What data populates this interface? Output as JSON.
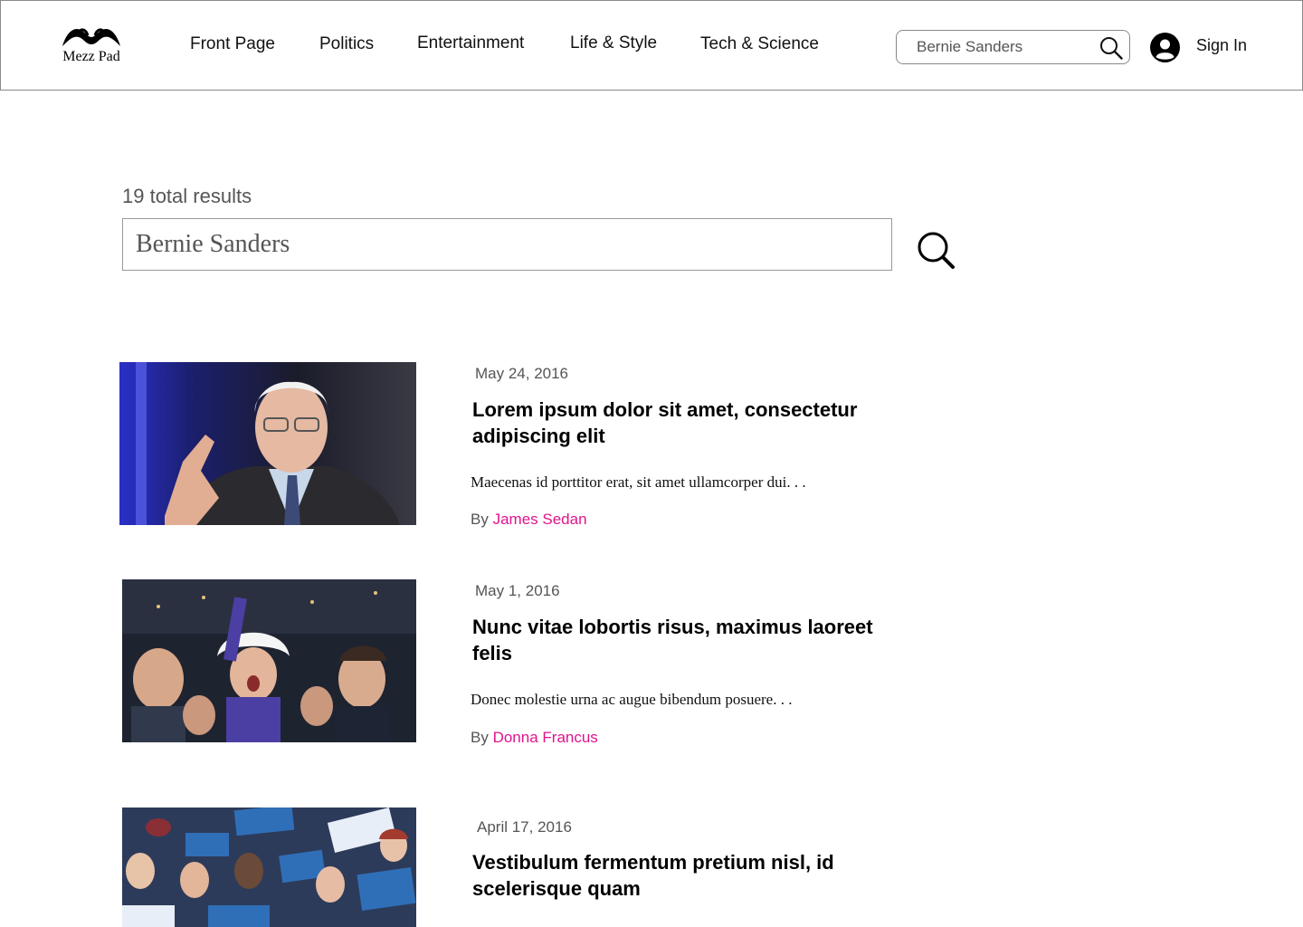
{
  "header": {
    "logo_text": "Mezz Pad",
    "nav": [
      "Front Page",
      "Politics",
      "Entertainment",
      "Life & Style",
      "Tech & Science"
    ],
    "search_value": "Bernie Sanders",
    "signin_label": "Sign In",
    "icons": {
      "search": "search-icon",
      "user": "user-avatar-icon"
    }
  },
  "results": {
    "count_label": "19 total results",
    "search_value": "Bernie Sanders"
  },
  "colors": {
    "accent": "#e0148c",
    "text_muted": "#555555",
    "border": "#8a8a8a"
  },
  "articles": [
    {
      "date": "May 24, 2016",
      "title": "Lorem ipsum dolor sit amet, consectetur adipiscing elit",
      "excerpt": "Maecenas id porttitor erat, sit amet ullamcorper dui. . .",
      "by": "By",
      "author": "James Sedan"
    },
    {
      "date": "May 1, 2016",
      "title": "Nunc vitae lobortis risus, maximus laoreet felis",
      "excerpt": "Donec molestie urna ac augue bibendum posuere. . .",
      "by": "By",
      "author": "Donna Francus"
    },
    {
      "date": "April 17, 2016",
      "title": "Vestibulum fermentum pretium nisl, id scelerisque quam",
      "excerpt": "",
      "by": "",
      "author": ""
    }
  ]
}
